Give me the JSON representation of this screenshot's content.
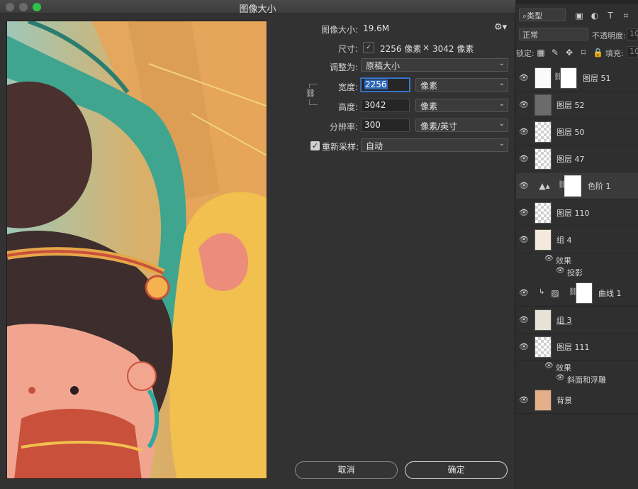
{
  "window": {
    "title": "图像大小"
  },
  "dialog": {
    "image_size_label": "图像大小:",
    "image_size_value": "19.6M",
    "dimensions_label": "尺寸:",
    "dimensions_width": "2256 像素",
    "dimensions_sep": "×",
    "dimensions_height": "3042 像素",
    "fit_to_label": "调整为:",
    "fit_to_value": "原稿大小",
    "width_label": "宽度:",
    "width_value": "2256",
    "width_unit": "像素",
    "height_label": "高度:",
    "height_value": "3042",
    "height_unit": "像素",
    "resolution_label": "分辨率:",
    "resolution_value": "300",
    "resolution_unit": "像素/英寸",
    "resample_label": "重新采样:",
    "resample_checked": true,
    "resample_value": "自动",
    "cancel_label": "取消",
    "ok_label": "确定"
  },
  "panel": {
    "filter_value": "类型",
    "blend_mode": "正常",
    "opacity_label": "不透明度:",
    "opacity_value": "10",
    "lock_label": "锁定:",
    "fill_label": "填充:",
    "fill_value": "10",
    "layers": [
      {
        "name": "图层 51"
      },
      {
        "name": "图层 52"
      },
      {
        "name": "图层 50"
      },
      {
        "name": "图层 47"
      },
      {
        "name": "色阶 1"
      },
      {
        "name": "图层 110"
      },
      {
        "name": "组 4",
        "effects_label": "效果",
        "effect": "投影"
      },
      {
        "name": "曲线 1"
      },
      {
        "name": "组 3"
      },
      {
        "name": "图层 111",
        "effects_label": "效果",
        "effect": "斜面和浮雕"
      },
      {
        "name": "背景"
      }
    ]
  },
  "colors": {
    "accent": "#2f66b8",
    "green_button": "#2fc24a"
  }
}
